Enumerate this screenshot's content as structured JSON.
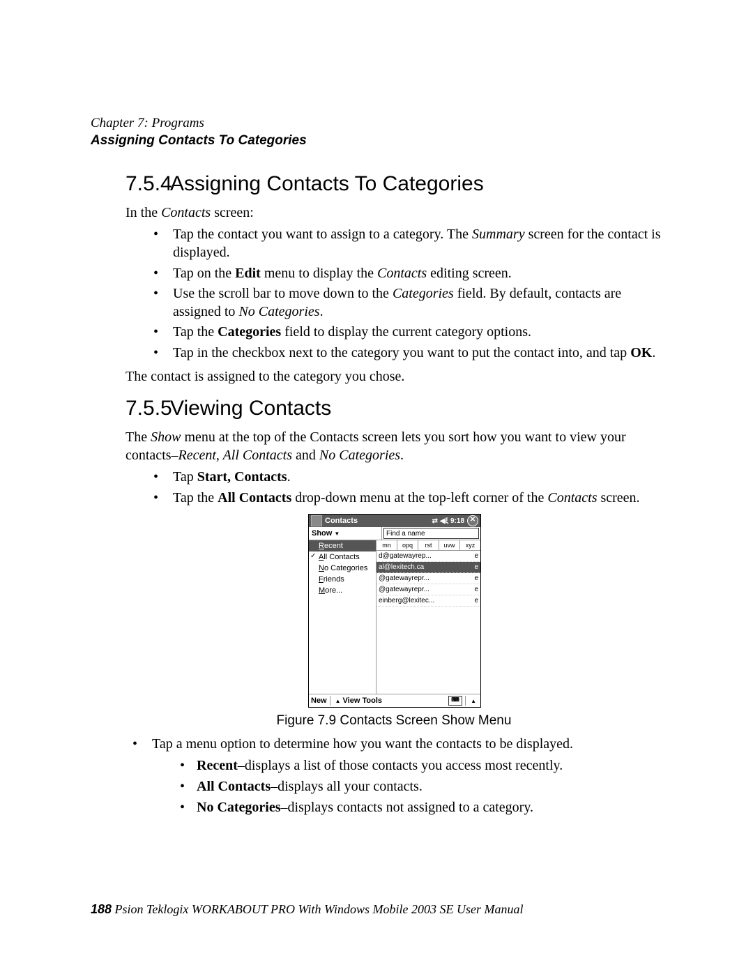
{
  "header": {
    "chapter": "Chapter 7: Programs",
    "section_title": "Assigning Contacts To Categories"
  },
  "s754": {
    "num": "7.5.4",
    "title": "Assigning Contacts To Categories",
    "intro_pre": "In the ",
    "intro_em": "Contacts",
    "intro_post": " screen:",
    "b1_a": "Tap the contact you want to assign to a category. The ",
    "b1_em": "Summary",
    "b1_b": " screen for the contact is displayed.",
    "b2_a": "Tap on the ",
    "b2_bold": "Edit",
    "b2_b": " menu to display the ",
    "b2_em": "Contacts",
    "b2_c": " editing screen.",
    "b3_a": "Use the scroll bar to move down to the ",
    "b3_em": "Categories",
    "b3_b": " field. By default, contacts are assigned to ",
    "b3_em2": "No Categories",
    "b3_c": ".",
    "b4_a": "Tap the ",
    "b4_bold": "Categories",
    "b4_b": " field to display the current category options.",
    "b5_a": "Tap in the checkbox next to the category you want to put the contact into, and tap ",
    "b5_bold": "OK",
    "b5_b": ".",
    "outro": "The contact is assigned to the category you chose."
  },
  "s755": {
    "num": "7.5.5",
    "title": "Viewing Contacts",
    "p1_a": "The ",
    "p1_em1": "Show",
    "p1_b": " menu at the top of the Contacts screen lets you sort how you want to view your contacts–",
    "p1_em2": "Recent, All Contacts",
    "p1_c": " and ",
    "p1_em3": "No Categories",
    "p1_d": ".",
    "b1_a": "Tap ",
    "b1_bold": "Start, Contacts",
    "b1_b": ".",
    "b2_a": "Tap the ",
    "b2_bold": "All Contacts",
    "b2_b": " drop-down menu at the top-left corner of the ",
    "b2_em": "Contacts",
    "b2_c": " screen.",
    "post_b1": "Tap a menu option to determine how you want the contacts to be displayed.",
    "sub1_bold": "Recent",
    "sub1_txt": "–displays a list of those contacts you access most recently.",
    "sub2_bold": "All Contacts",
    "sub2_txt": "–displays all your contacts.",
    "sub3_bold": "No Categories",
    "sub3_txt": "–displays contacts not assigned to a category."
  },
  "figure": {
    "caption": "Figure 7.9 Contacts Screen Show Menu",
    "titlebar": "Contacts",
    "time": "9:18",
    "show_label": "Show",
    "find_label": "Find a name",
    "menu": {
      "recent_u": "R",
      "recent_rest": "ecent",
      "all_u": "A",
      "all_rest": "ll Contacts",
      "nocat_u": "N",
      "nocat_rest": "o Categories",
      "friends_u": "F",
      "friends_rest": "riends",
      "more_u": "M",
      "more_rest": "ore..."
    },
    "alpha": [
      "mn",
      "opq",
      "rst",
      "uvw",
      "xyz"
    ],
    "rows": [
      {
        "em": "d@gatewayrep...",
        "tag": "e"
      },
      {
        "em": "al@lexitech.ca",
        "tag": "e",
        "hl": true
      },
      {
        "em": "@gatewayrepr...",
        "tag": "e"
      },
      {
        "em": "@gatewayrepr...",
        "tag": "e"
      },
      {
        "em": "einberg@lexitec...",
        "tag": "e"
      }
    ],
    "bottom": {
      "new": "New",
      "view": "View",
      "tools": "Tools"
    }
  },
  "footer": {
    "page": "188",
    "text": " Psion Teklogix WORKABOUT PRO With Windows Mobile 2003 SE User Manual"
  }
}
